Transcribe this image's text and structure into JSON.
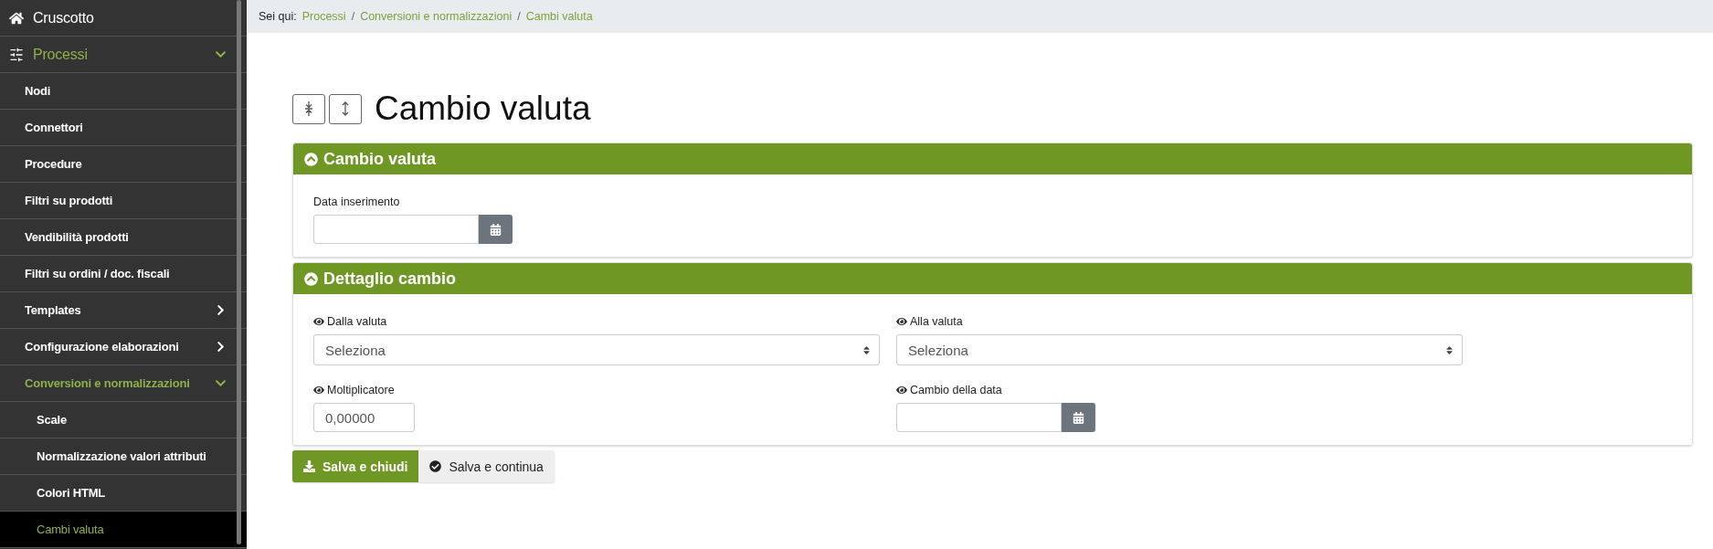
{
  "sidebar": {
    "items": [
      {
        "label": "Cruscotto",
        "selected": false
      },
      {
        "label": "Processi",
        "selected": false,
        "expanded": true,
        "children": [
          {
            "label": "Nodi",
            "selected": false
          },
          {
            "label": "Connettori",
            "selected": false
          },
          {
            "label": "Procedure",
            "selected": false
          },
          {
            "label": "Filtri su prodotti",
            "selected": false
          },
          {
            "label": "Vendibilità prodotti",
            "selected": false
          },
          {
            "label": "Filtri su ordini / doc. fiscali",
            "selected": false
          },
          {
            "label": "Templates",
            "selected": false,
            "expanded": false
          },
          {
            "label": "Configurazione elaborazioni",
            "selected": false,
            "expanded": false
          },
          {
            "label": "Conversioni e normalizzazioni",
            "selected": false,
            "expanded": true,
            "children": [
              {
                "label": "Scale",
                "selected": false
              },
              {
                "label": "Normalizzazione valori attributi",
                "selected": false
              },
              {
                "label": "Colori HTML",
                "selected": false
              },
              {
                "label": "Cambi valuta",
                "selected": true
              }
            ]
          }
        ]
      }
    ]
  },
  "breadcrumb": {
    "prefix": "Sei qui:",
    "items": [
      "Processi",
      "Conversioni e normalizzazioni",
      "Cambi valuta"
    ],
    "separator": "/"
  },
  "page_title": "Cambio valuta",
  "panels": [
    {
      "title": "Cambio valuta",
      "expanded": true,
      "fields": [
        {
          "kind": "date",
          "label": "Data inserimento",
          "visible_icon": false
        }
      ]
    },
    {
      "title": "Dettaglio cambio",
      "expanded": true,
      "fields": [
        {
          "kind": "select",
          "label": "Dalla valuta",
          "visible_icon": true,
          "value": "Seleziona"
        },
        {
          "kind": "select",
          "label": "Alla valuta",
          "visible_icon": true,
          "value": "Seleziona"
        },
        {
          "kind": "number",
          "label": "Moltiplicatore",
          "visible_icon": true,
          "value": "0,00000"
        },
        {
          "kind": "date",
          "label": "Cambio della data",
          "visible_icon": true
        }
      ]
    }
  ],
  "actions": [
    {
      "label": "Salva e chiudi",
      "kind": "primary"
    },
    {
      "label": "Salva e continua",
      "kind": "secondary"
    }
  ]
}
